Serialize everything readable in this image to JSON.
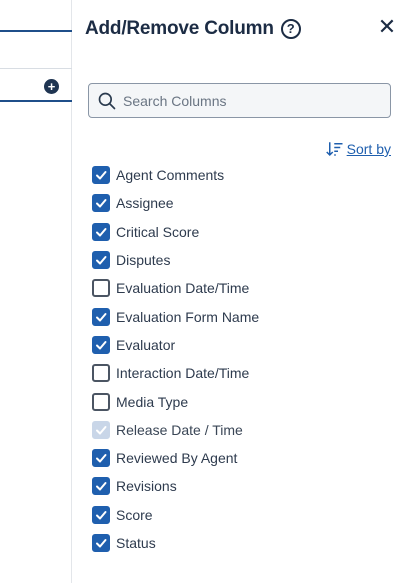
{
  "panel": {
    "title": "Add/Remove Column",
    "help_icon": "question-circle-icon",
    "close_icon": "close-icon"
  },
  "search": {
    "placeholder": "Search Columns",
    "value": ""
  },
  "sort": {
    "label": "Sort by",
    "icon": "sort-descending-icon"
  },
  "columns": [
    {
      "label": "Agent Comments",
      "checked": true,
      "disabled": false
    },
    {
      "label": "Assignee",
      "checked": true,
      "disabled": false
    },
    {
      "label": "Critical Score",
      "checked": true,
      "disabled": false
    },
    {
      "label": "Disputes",
      "checked": true,
      "disabled": false
    },
    {
      "label": "Evaluation Date/Time",
      "checked": false,
      "disabled": false
    },
    {
      "label": "Evaluation Form Name",
      "checked": true,
      "disabled": false
    },
    {
      "label": "Evaluator",
      "checked": true,
      "disabled": false
    },
    {
      "label": "Interaction Date/Time",
      "checked": false,
      "disabled": false
    },
    {
      "label": "Media Type",
      "checked": false,
      "disabled": false
    },
    {
      "label": "Release Date / Time",
      "checked": true,
      "disabled": true
    },
    {
      "label": "Reviewed By Agent",
      "checked": true,
      "disabled": false
    },
    {
      "label": "Revisions",
      "checked": true,
      "disabled": false
    },
    {
      "label": "Score",
      "checked": true,
      "disabled": false
    },
    {
      "label": "Status",
      "checked": true,
      "disabled": false
    }
  ],
  "colors": {
    "accent": "#1f5fae",
    "title": "#1c2c44",
    "disabled_check": "#c9d6e8"
  }
}
